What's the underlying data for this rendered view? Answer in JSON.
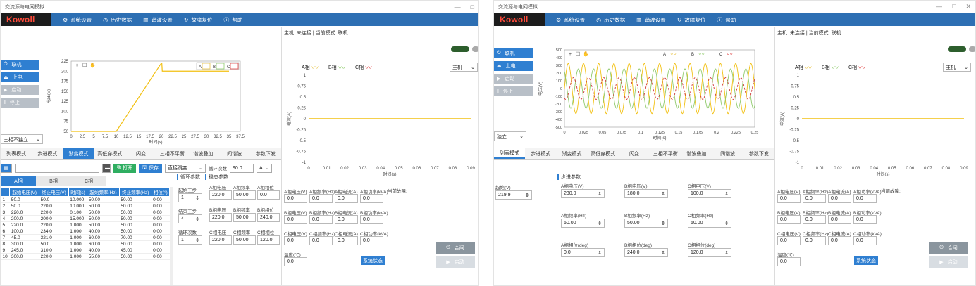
{
  "app": {
    "title": "交流源与电网模拟",
    "logo": "Kowoll",
    "menu": [
      {
        "icon": "gear-icon",
        "label": "系统设置"
      },
      {
        "icon": "clock-icon",
        "label": "历史数据"
      },
      {
        "icon": "chart-icon",
        "label": "谐波设置"
      },
      {
        "icon": "reset-icon",
        "label": "故障复位"
      },
      {
        "icon": "info-icon",
        "label": "帮助"
      }
    ],
    "window_controls": [
      "—",
      "□",
      "✕"
    ]
  },
  "sidebar": {
    "buttons": [
      {
        "icon": "power-icon",
        "label": "联机"
      },
      {
        "icon": "unlock-icon",
        "label": "上电"
      },
      {
        "icon": "play-icon",
        "label": "启动"
      },
      {
        "icon": "stop-icon",
        "label": "停止"
      }
    ],
    "mode_select": "三相不独立",
    "mode_select_w2": "独立"
  },
  "w1_plot": {
    "ylabel": "电压(V)",
    "xlabel": "时间(s)",
    "yticks": [
      "225",
      "200",
      "175",
      "150",
      "125",
      "100",
      "75",
      "50"
    ],
    "xticks": [
      "0",
      "2.5",
      "5",
      "7.5",
      "10",
      "12.5",
      "15",
      "17.5",
      "20",
      "22.5",
      "25",
      "27.5",
      "30",
      "32.5",
      "35",
      "37.5"
    ],
    "toolbar": [
      "+",
      "☐",
      "✋"
    ],
    "legend": [
      {
        "name": "A",
        "color": "#e8c44a"
      },
      {
        "name": "B",
        "color": "#8fca6b"
      },
      {
        "name": "C",
        "color": "#e04a4a"
      }
    ]
  },
  "w2_plot": {
    "ylabel": "电压(V)",
    "xlabel": "时间(s)",
    "yticks": [
      "500",
      "400",
      "300",
      "200",
      "100",
      "0",
      "-100",
      "-200",
      "-300",
      "-400",
      "-500"
    ],
    "xticks": [
      "0",
      "0.025",
      "0.05",
      "0.075",
      "0.1",
      "0.125",
      "0.15",
      "0.175",
      "0.2",
      "0.225",
      "0.25"
    ],
    "toolbar": [
      "+",
      "☐",
      "✋"
    ],
    "legend": [
      {
        "name": "A",
        "color": "#e8c44a"
      },
      {
        "name": "B",
        "color": "#8fca6b"
      },
      {
        "name": "C",
        "color": "#e04a4a"
      }
    ]
  },
  "tabs": [
    "列表模式",
    "步进模式",
    "渐变模式",
    "高低穿模式",
    "闪变",
    "三相不平衡",
    "谐波叠加",
    "间谐波",
    "参数下发"
  ],
  "w2_tabs": [
    "列表模式",
    "步进模式",
    "渐变模式",
    "高低穿模式",
    "闪变",
    "三相不平衡",
    "谐波叠加",
    "间谐波",
    "参数下发"
  ],
  "w1_toolbar": {
    "open_label": "打开",
    "save_label": "保存",
    "ramp_select": "直接跳变",
    "loop_label": "循环次数",
    "loop_value": "90.0",
    "unit_select": "A"
  },
  "phase_tabs": [
    "A相",
    "B相",
    "C相"
  ],
  "grid": {
    "headers": [
      "",
      "起始电压(V)",
      "终止电压(V)",
      "时间(s)",
      "起始频率(Hz)",
      "终止频率(Hz)",
      "相位(°)"
    ],
    "rows": [
      [
        "1",
        "50.0",
        "50.0",
        "10.000",
        "50.00",
        "50.00",
        "0.00"
      ],
      [
        "2",
        "50.0",
        "220.0",
        "10.000",
        "50.00",
        "50.00",
        "0.00"
      ],
      [
        "3",
        "220.0",
        "220.0",
        "0.100",
        "50.00",
        "50.00",
        "0.00"
      ],
      [
        "4",
        "200.0",
        "200.0",
        "15.000",
        "50.00",
        "50.00",
        "0.00"
      ],
      [
        "5",
        "220.0",
        "220.0",
        "1.000",
        "50.00",
        "50.00",
        "0.00"
      ],
      [
        "6",
        "100.0",
        "234.0",
        "1.000",
        "40.00",
        "50.00",
        "0.00"
      ],
      [
        "7",
        "45.0",
        "321.0",
        "1.000",
        "60.00",
        "70.00",
        "0.00"
      ],
      [
        "8",
        "300.0",
        "50.0",
        "1.000",
        "60.00",
        "50.00",
        "0.00"
      ],
      [
        "9",
        "245.0",
        "310.0",
        "1.000",
        "40.00",
        "45.00",
        "0.00"
      ],
      [
        "10",
        "300.0",
        "220.0",
        "1.000",
        "55.00",
        "50.00",
        "0.00"
      ]
    ]
  },
  "w1_params": {
    "cycle_title": "循环参数",
    "ramp_title": "稳态参数",
    "start_label": "起始工步",
    "start_value": "1",
    "end_label": "结束工步",
    "end_value": "4",
    "loop_label": "循环次数",
    "loop_value": "1",
    "col_heads": [
      "A相电压",
      "A相频率",
      "A相相位"
    ],
    "rows": [
      [
        "220.0",
        "50.00",
        "0.0"
      ],
      [
        "220.0",
        "50.00",
        "240.0"
      ],
      [
        "220.0",
        "50.00",
        "120.0"
      ]
    ],
    "row_heads": [
      [
        "A相电压",
        "A相频率",
        "A相相位"
      ],
      [
        "B相电压",
        "B相频率",
        "B相相位"
      ],
      [
        "C相电压",
        "C相频率",
        "C相相位"
      ]
    ]
  },
  "w2_params": {
    "title": "步进参数",
    "start_label": "起始(V)",
    "start_value": "219.9",
    "fields": [
      {
        "label": "A相电压(V)",
        "value": "230.0"
      },
      {
        "label": "B相电压(V)",
        "value": "180.0"
      },
      {
        "label": "C相电压(V)",
        "value": "100.0"
      },
      {
        "label": "A相频率(Hz)",
        "value": "50.00"
      },
      {
        "label": "B相频率(Hz)",
        "value": "50.00"
      },
      {
        "label": "C相频率(Hz)",
        "value": "50.00"
      },
      {
        "label": "A相相位(deg)",
        "value": "0.0"
      },
      {
        "label": "B相相位(deg)",
        "value": "240.0"
      },
      {
        "label": "C相相位(deg)",
        "value": "120.0"
      }
    ]
  },
  "right_panel": {
    "status": "主机: 未连接 | 当前模式: 联机",
    "status_w2": "主机: 未连接 | 当前模式: 联机",
    "legend": [
      {
        "name": "A相",
        "color": "#e8c44a"
      },
      {
        "name": "B相",
        "color": "#8fca6b"
      },
      {
        "name": "C相",
        "color": "#e04a4a"
      }
    ],
    "dropdown": "主机",
    "ylabel": "电流(A)",
    "xlabel": "时间(s)",
    "yticks": [
      "1",
      "0.75",
      "0.5",
      "0.25",
      "0",
      "-0.25",
      "-0.5",
      "-0.75",
      "-1"
    ],
    "xticks": [
      "0",
      "0.01",
      "0.02",
      "0.03",
      "0.04",
      "0.05",
      "0.06",
      "0.07",
      "0.08",
      "0.09"
    ],
    "meas_labels": [
      [
        "A相电压(V)",
        "A相频率(Hz)",
        "A相电流(A)",
        "A相功率(kVA)"
      ],
      [
        "B相电压(V)",
        "B相频率(Hz)",
        "B相电流(A)",
        "B相功率(kVA)"
      ],
      [
        "C相电压(V)",
        "C相频率(Hz)",
        "C相电流(A)",
        "C相功率(kVA)"
      ]
    ],
    "meas_values": [
      [
        "0.0",
        "0.0",
        "0.0",
        "0.0"
      ],
      [
        "0.0",
        "0.0",
        "0.0",
        "0.0"
      ],
      [
        "0.0",
        "0.0",
        "0.0",
        "0.0"
      ]
    ],
    "temp_label": "温度(℃)",
    "temp_value": "0.0",
    "fault_label": "当前故障:",
    "close_label": "合闸",
    "start_label": "启动",
    "fault_btn": "系统状态"
  }
}
